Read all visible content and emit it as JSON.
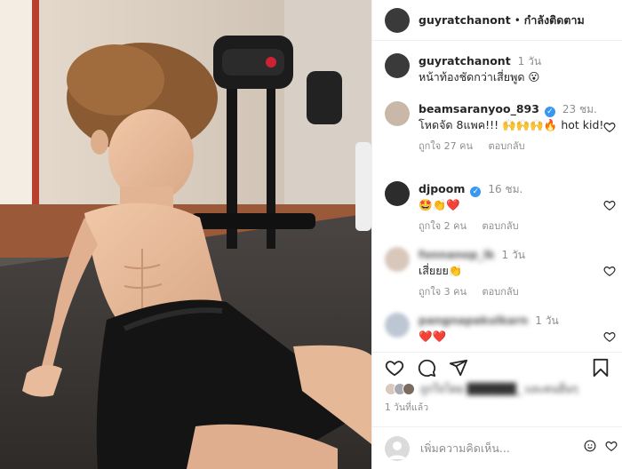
{
  "post": {
    "author": "guyratchanont",
    "header_separator": "•",
    "follow_label": "กำลังติดตาม",
    "caption": "หน้าท้องชัดกว่าเสี่ยพูด 😮",
    "caption_time": "1 วัน",
    "time_ago": "1 วันที่แล้ว",
    "liked_by_text": "ถูกใจโดย ██████_ และคนอื่นๆ"
  },
  "comments": [
    {
      "username": "beamsaranyoo_893",
      "verified": true,
      "time": "23 ชม.",
      "text": "โหดจัด 8แพค!!! 🙌🙌🙌🔥 hot kid!",
      "likes": "ถูกใจ 27 คน",
      "reply": "ตอบกลับ"
    },
    {
      "username": "djpoom",
      "verified": true,
      "time": "16 ชม.",
      "text": "🤩👏❤️",
      "likes": "ถูกใจ 2 คน",
      "reply": "ตอบกลับ"
    },
    {
      "username": "fonnanop_lk",
      "verified": false,
      "time": "1 วัน",
      "text": "เสี่ยยย👏",
      "likes": "ถูกใจ 3 คน",
      "reply": "ตอบกลับ"
    },
    {
      "username": "pangnapakulkarn",
      "verified": false,
      "time": "1 วัน",
      "text": "❤️❤️",
      "likes": "",
      "reply": ""
    }
  ],
  "add_comment": {
    "placeholder": "เพิ่มความคิดเห็น..."
  },
  "icons": {
    "like": "heart-icon",
    "comment": "comment-icon",
    "share": "share-icon",
    "save": "bookmark-icon",
    "emoji": "emoji-icon"
  },
  "colors": {
    "verified": "#3897f0",
    "secondary_text": "#8e8e8e",
    "border": "#efefef"
  }
}
